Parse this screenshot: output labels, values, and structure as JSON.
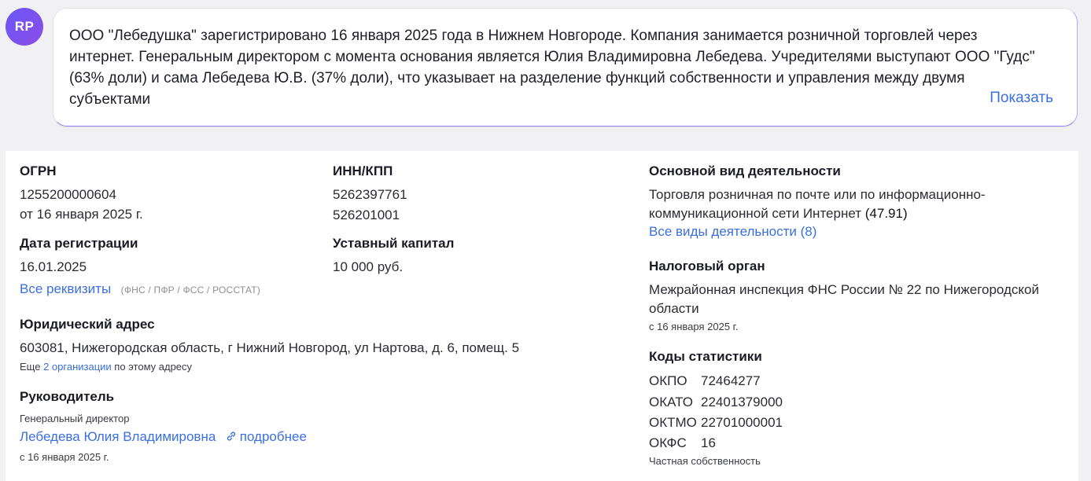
{
  "avatar": {
    "initials": "RP"
  },
  "summary": {
    "text": "ООО \"Лебедушка\" зарегистрировано 16 января 2025 года в Нижнем Новгороде. Компания занимается розничной торговлей через интернет. Генеральным директором с момента основания является Юлия Владимировна Лебедева. Учредителями выступают ООО \"Гудс\" (63% доли) и сама Лебедева Ю.В. (37% доли), что указывает на разделение функций собственности и управления между двумя субъектами",
    "show_label": "Показать"
  },
  "ogrn": {
    "label": "ОГРН",
    "value": "1255200000604",
    "date": "от 16 января 2025 г."
  },
  "inn": {
    "label": "ИНН/КПП",
    "inn": "5262397761",
    "kpp": "526201001"
  },
  "reg_date": {
    "label": "Дата регистрации",
    "value": "16.01.2025"
  },
  "capital": {
    "label": "Уставный капитал",
    "value": "10 000 руб."
  },
  "requisites": {
    "link": "Все реквизиты",
    "note": "(ФНС / ПФР / ФСС / РОССТАТ)"
  },
  "address": {
    "label": "Юридический адрес",
    "value": "603081, Нижегородская область, г Нижний Новгород, ул Нартова, д. 6, помещ. 5",
    "more_prefix": "Еще",
    "more_link": "2 организации",
    "more_suffix": "по этому адресу"
  },
  "head": {
    "label": "Руководитель",
    "role": "Генеральный директор",
    "name": "Лебедева Юлия Владимировна",
    "details_link": "подробнее",
    "since": "с 16 января 2025 г."
  },
  "activity": {
    "label": "Основной вид деятельности",
    "line1": "Торговля розничная по почте или по информационно-",
    "line2": "коммуникационной сети Интернет",
    "code": "(47.91)",
    "all_link": "Все виды деятельности (8)"
  },
  "tax": {
    "label": "Налоговый орган",
    "line1": "Межрайонная инспекция ФНС России № 22 по Нижегородской",
    "line2": "области",
    "since": "с 16 января 2025 г."
  },
  "stats": {
    "label": "Коды статистики",
    "rows": [
      {
        "code": "ОКПО",
        "value": "72464277"
      },
      {
        "code": "ОКАТО",
        "value": "22401379000"
      },
      {
        "code": "ОКТМО",
        "value": "22701000001"
      },
      {
        "code": "ОКФС",
        "value": "16"
      }
    ],
    "okfs_note": "Частная собственность"
  }
}
